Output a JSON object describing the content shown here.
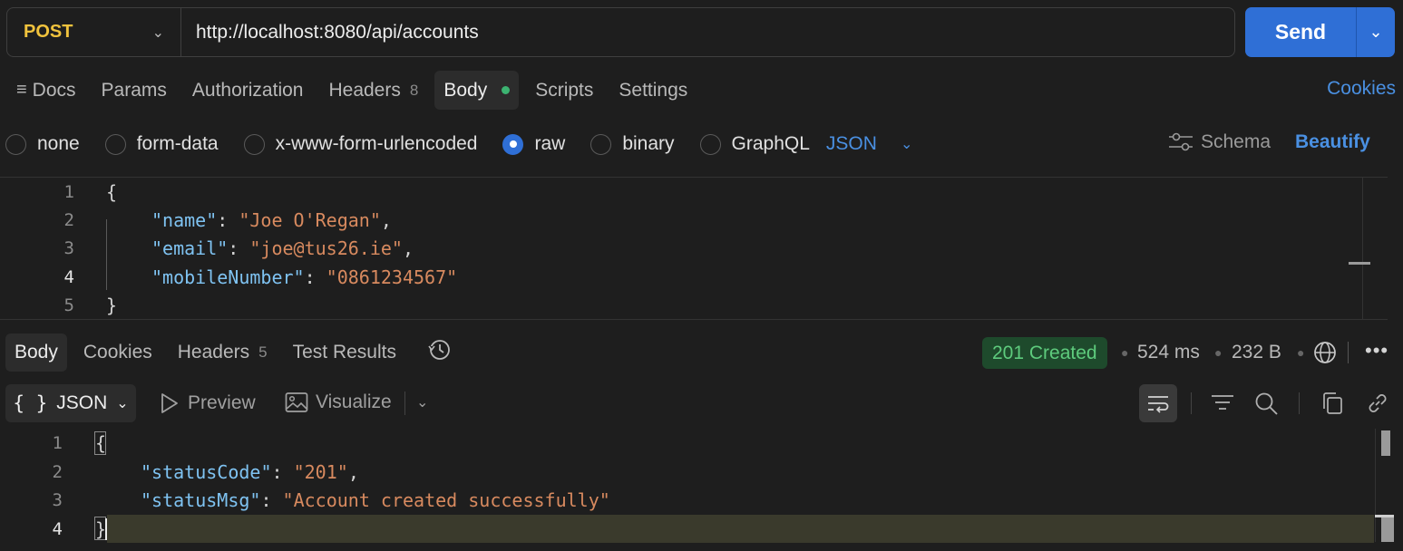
{
  "request": {
    "method": "POST",
    "url": "http://localhost:8080/api/accounts",
    "send_label": "Send"
  },
  "request_tabs": [
    {
      "label": "Docs"
    },
    {
      "label": "Params"
    },
    {
      "label": "Authorization"
    },
    {
      "label": "Headers",
      "count": "8"
    },
    {
      "label": "Body",
      "active": true
    },
    {
      "label": "Scripts"
    },
    {
      "label": "Settings"
    }
  ],
  "cookies_link": "Cookies",
  "body_types": [
    {
      "label": "none",
      "checked": false
    },
    {
      "label": "form-data",
      "checked": false
    },
    {
      "label": "x-www-form-urlencoded",
      "checked": false
    },
    {
      "label": "raw",
      "checked": true
    },
    {
      "label": "binary",
      "checked": false
    },
    {
      "label": "GraphQL",
      "checked": false
    }
  ],
  "raw_format": "JSON",
  "schema_label": "Schema",
  "beautify_label": "Beautify",
  "request_body": {
    "line_numbers": [
      "1",
      "2",
      "3",
      "4",
      "5"
    ],
    "open": "{",
    "close": "}",
    "fields": [
      {
        "key": "\"name\"",
        "value": "\"Joe O'Regan\"",
        "comma": ","
      },
      {
        "key": "\"email\"",
        "value": "\"joe@tus26.ie\"",
        "comma": ","
      },
      {
        "key": "\"mobileNumber\"",
        "value": "\"0861234567\"",
        "comma": ""
      }
    ]
  },
  "response_tabs": [
    {
      "label": "Body",
      "active": true
    },
    {
      "label": "Cookies"
    },
    {
      "label": "Headers",
      "count": "5"
    },
    {
      "label": "Test Results"
    }
  ],
  "response_meta": {
    "status": "201 Created",
    "time": "524 ms",
    "size": "232 B",
    "status_color": "#5ecb7d"
  },
  "response_toolbar": {
    "format_icon": "{ }",
    "format": "JSON",
    "preview": "Preview",
    "visualize": "Visualize"
  },
  "response_body": {
    "line_numbers": [
      "1",
      "2",
      "3",
      "4"
    ],
    "open": "{",
    "close": "}",
    "fields": [
      {
        "key": "\"statusCode\"",
        "value": "\"201\"",
        "comma": ","
      },
      {
        "key": "\"statusMsg\"",
        "value": "\"Account created successfully\"",
        "comma": ""
      }
    ]
  }
}
